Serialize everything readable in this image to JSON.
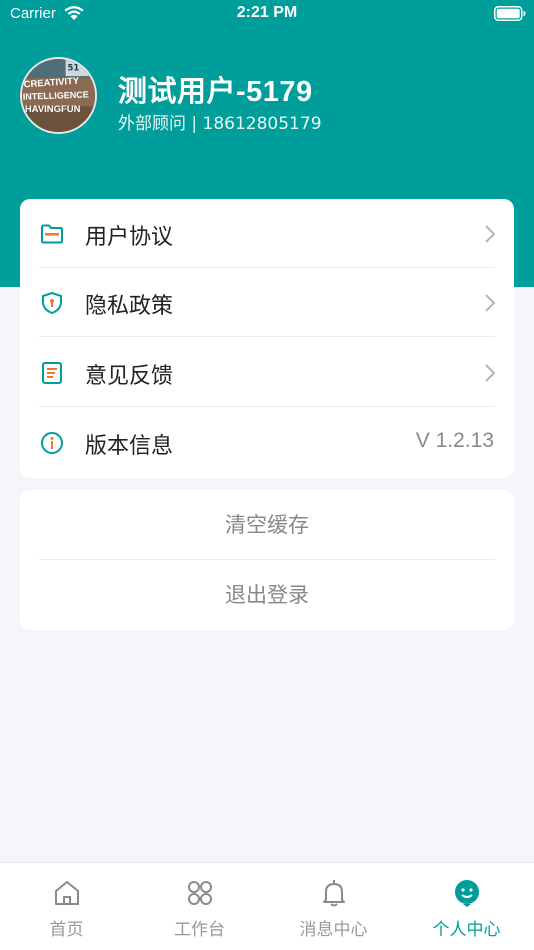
{
  "status_bar": {
    "carrier": "Carrier",
    "time": "2:21 PM",
    "wifi_icon": "wifi-icon",
    "battery_icon": "battery-full-icon"
  },
  "colors": {
    "brand": "#009e9b",
    "accent_orange": "#f07a2c",
    "background": "#f5f6fa"
  },
  "profile": {
    "name": "测试用户-5179",
    "info": "外部顾问 | 18612805179",
    "avatar_text": [
      "CREATIVITY",
      "INTELLIGENCE",
      "HAVINGFUN",
      "51"
    ]
  },
  "menu": {
    "items": [
      {
        "label": "用户协议",
        "icon": "folder-icon",
        "chevron": true
      },
      {
        "label": "隐私政策",
        "icon": "shield-icon",
        "chevron": true
      },
      {
        "label": "意见反馈",
        "icon": "feedback-doc-icon",
        "chevron": true
      },
      {
        "label": "版本信息",
        "icon": "info-icon",
        "value": "V 1.2.13"
      }
    ]
  },
  "actions": {
    "clear_cache": "清空缓存",
    "logout": "退出登录"
  },
  "tabs": [
    {
      "label": "首页",
      "icon": "home-icon",
      "active": false
    },
    {
      "label": "工作台",
      "icon": "grid-icon",
      "active": false
    },
    {
      "label": "消息中心",
      "icon": "bell-icon",
      "active": false
    },
    {
      "label": "个人中心",
      "icon": "person-icon",
      "active": true
    }
  ]
}
